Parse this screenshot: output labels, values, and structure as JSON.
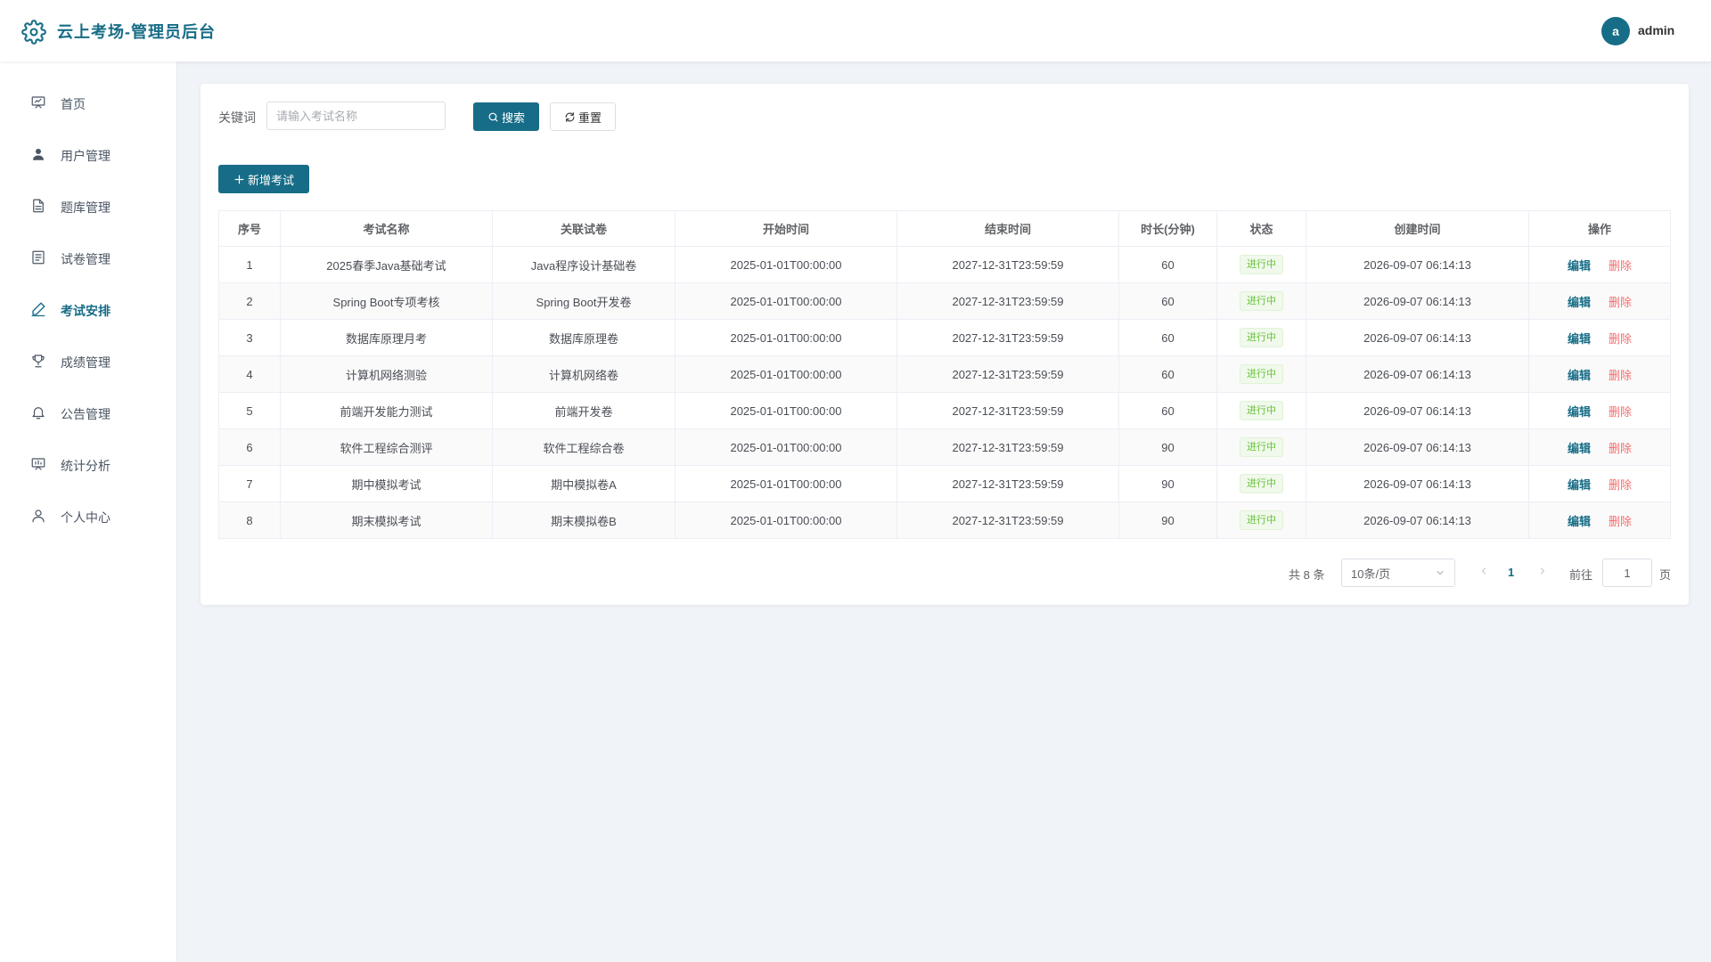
{
  "app": {
    "title": "云上考场-管理员后台",
    "icon": "gear-icon",
    "accent": "#176d87"
  },
  "user": {
    "avatar_letter": "a",
    "name": "admin"
  },
  "sidebar": {
    "items": [
      {
        "label": "首页",
        "icon": "dashboard-icon",
        "active": false
      },
      {
        "label": "用户管理",
        "icon": "user-icon",
        "active": false
      },
      {
        "label": "题库管理",
        "icon": "document-icon",
        "active": false
      },
      {
        "label": "试卷管理",
        "icon": "paper-icon",
        "active": false
      },
      {
        "label": "考试安排",
        "icon": "pen-icon",
        "active": true
      },
      {
        "label": "成绩管理",
        "icon": "trophy-icon",
        "active": false
      },
      {
        "label": "公告管理",
        "icon": "bell-icon",
        "active": false
      },
      {
        "label": "统计分析",
        "icon": "chart-icon",
        "active": false
      },
      {
        "label": "个人中心",
        "icon": "profile-icon",
        "active": false
      }
    ]
  },
  "search": {
    "label": "关键词",
    "placeholder": "请输入考试名称",
    "value": "",
    "search_label": "搜索",
    "reset_label": "重置"
  },
  "toolbar": {
    "add_label": "新增考试"
  },
  "table": {
    "columns": [
      "序号",
      "考试名称",
      "关联试卷",
      "开始时间",
      "结束时间",
      "时长(分钟)",
      "状态",
      "创建时间",
      "操作"
    ],
    "edit_label": "编辑",
    "delete_label": "删除",
    "rows": [
      {
        "index": "1",
        "name": "2025春季Java基础考试",
        "paper": "Java程序设计基础卷",
        "start": "2025-01-01T00:00:00",
        "end": "2027-12-31T23:59:59",
        "duration": "60",
        "status": "进行中",
        "created": "2026-09-07 06:14:13"
      },
      {
        "index": "2",
        "name": "Spring Boot专项考核",
        "paper": "Spring Boot开发卷",
        "start": "2025-01-01T00:00:00",
        "end": "2027-12-31T23:59:59",
        "duration": "60",
        "status": "进行中",
        "created": "2026-09-07 06:14:13"
      },
      {
        "index": "3",
        "name": "数据库原理月考",
        "paper": "数据库原理卷",
        "start": "2025-01-01T00:00:00",
        "end": "2027-12-31T23:59:59",
        "duration": "60",
        "status": "进行中",
        "created": "2026-09-07 06:14:13"
      },
      {
        "index": "4",
        "name": "计算机网络测验",
        "paper": "计算机网络卷",
        "start": "2025-01-01T00:00:00",
        "end": "2027-12-31T23:59:59",
        "duration": "60",
        "status": "进行中",
        "created": "2026-09-07 06:14:13"
      },
      {
        "index": "5",
        "name": "前端开发能力测试",
        "paper": "前端开发卷",
        "start": "2025-01-01T00:00:00",
        "end": "2027-12-31T23:59:59",
        "duration": "60",
        "status": "进行中",
        "created": "2026-09-07 06:14:13"
      },
      {
        "index": "6",
        "name": "软件工程综合测评",
        "paper": "软件工程综合卷",
        "start": "2025-01-01T00:00:00",
        "end": "2027-12-31T23:59:59",
        "duration": "90",
        "status": "进行中",
        "created": "2026-09-07 06:14:13"
      },
      {
        "index": "7",
        "name": "期中模拟考试",
        "paper": "期中模拟卷A",
        "start": "2025-01-01T00:00:00",
        "end": "2027-12-31T23:59:59",
        "duration": "90",
        "status": "进行中",
        "created": "2026-09-07 06:14:13"
      },
      {
        "index": "8",
        "name": "期末模拟考试",
        "paper": "期末模拟卷B",
        "start": "2025-01-01T00:00:00",
        "end": "2027-12-31T23:59:59",
        "duration": "90",
        "status": "进行中",
        "created": "2026-09-07 06:14:13"
      }
    ]
  },
  "pagination": {
    "total_label": "共 8 条",
    "page_size": "10条/页",
    "current_page": "1",
    "goto_label": "前往",
    "goto_value": "1",
    "goto_suffix": "页"
  }
}
